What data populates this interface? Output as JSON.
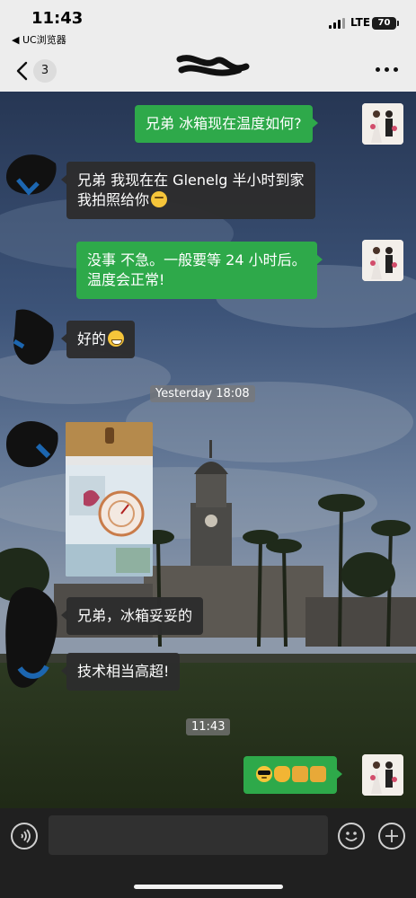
{
  "status_bar": {
    "time": "11:43",
    "back_app": "◀ UC浏览器",
    "network": "LTE",
    "battery": "70"
  },
  "nav": {
    "unread_count": "3"
  },
  "messages": [
    {
      "side": "out",
      "text": "兄弟 冰箱现在温度如何?"
    },
    {
      "side": "in",
      "line1": "兄弟 我现在在 Glenelg 半小时到家",
      "line2": "我拍照给你",
      "emoji": "thinking-face"
    },
    {
      "side": "out",
      "line1": "没事 不急。一般要等 24 小时后。",
      "line2": "温度会正常!"
    },
    {
      "side": "in",
      "text": "好的",
      "emoji": "grinning-face"
    },
    {
      "side": "in",
      "type": "image",
      "description": "fridge-thermometer-photo"
    },
    {
      "side": "in",
      "text": "兄弟，冰箱妥妥的"
    },
    {
      "side": "in",
      "text": "技术相当高超!"
    },
    {
      "side": "out",
      "emoji": [
        "sunglasses-face",
        "ok-hand",
        "handshake",
        "handshake"
      ]
    }
  ],
  "timestamps": {
    "t1": "Yesterday 18:08",
    "t2": "11:43"
  },
  "input": {
    "placeholder": ""
  },
  "icons": {
    "back": "chevron-left-icon",
    "more": "more-dots-icon",
    "voice": "voice-icon",
    "emoji": "emoji-icon",
    "plus": "plus-icon"
  },
  "colors": {
    "outgoing_bubble": "#2ea94a",
    "incoming_bubble": "#2d2d2d",
    "bar": "#ededed",
    "input_bar": "#202020"
  }
}
